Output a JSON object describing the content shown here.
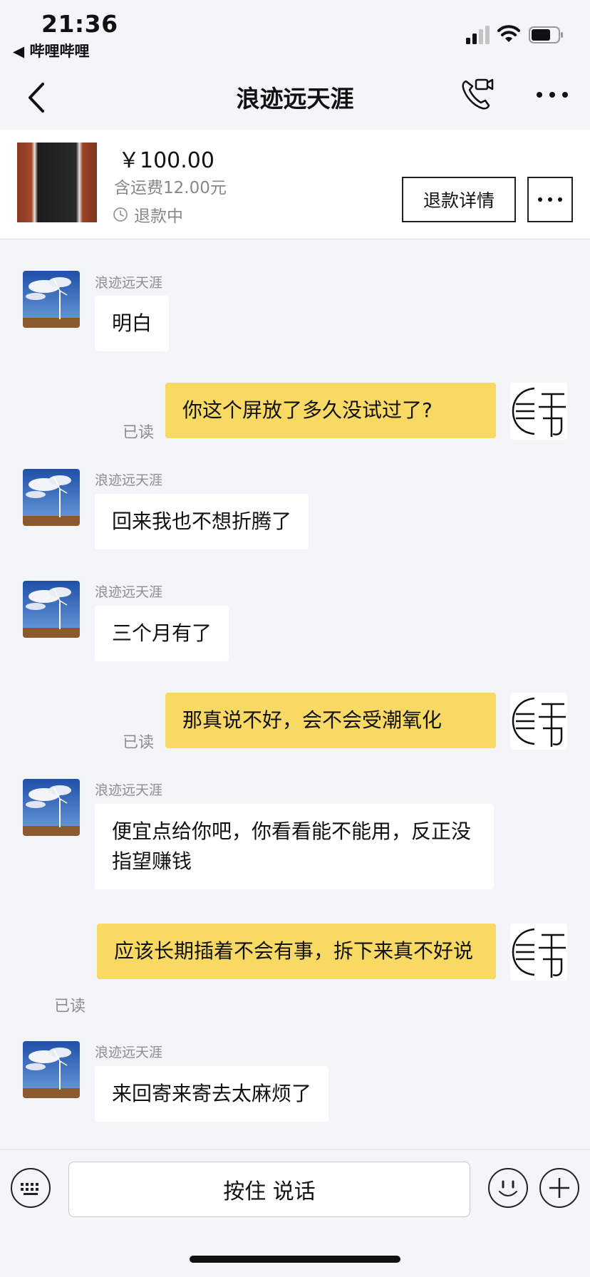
{
  "status_bar": {
    "time": "21:36",
    "back_app_label": "◀ 哔哩哔哩",
    "icons": [
      "signal-icon",
      "wifi-icon",
      "battery-icon"
    ]
  },
  "nav": {
    "title": "浪迹远天涯",
    "icons": [
      "back-chevron-icon",
      "phone-video-icon",
      "more-dots-icon"
    ]
  },
  "order": {
    "price": "￥100.00",
    "shipping": "含运费12.00元",
    "status": "退款中",
    "refund_button": "退款详情"
  },
  "messages": [
    {
      "side": "in",
      "sender": "浪迹远天涯",
      "text": "明白"
    },
    {
      "side": "out",
      "read": "已读",
      "text": "你这个屏放了多久没试过了?"
    },
    {
      "side": "in",
      "sender": "浪迹远天涯",
      "text": "回来我也不想折腾了"
    },
    {
      "side": "in",
      "sender": "浪迹远天涯",
      "text": "三个月有了"
    },
    {
      "side": "out",
      "read": "已读",
      "text": "那真说不好，会不会受潮氧化"
    },
    {
      "side": "in",
      "sender": "浪迹远天涯",
      "text": "便宜点给你吧，你看看能不能用，反正没指望赚钱"
    },
    {
      "side": "out",
      "read": "已读",
      "text": "应该长期插着不会有事，拆下来真不好说"
    },
    {
      "side": "in",
      "sender": "浪迹远天涯",
      "text": "来回寄来寄去太麻烦了"
    }
  ],
  "input": {
    "voice_label": "按住 说话"
  },
  "colors": {
    "background": "#f4f5f9",
    "outgoing_bubble": "#f8d964",
    "incoming_bubble": "#ffffff",
    "muted_text": "#8d8d8d"
  }
}
